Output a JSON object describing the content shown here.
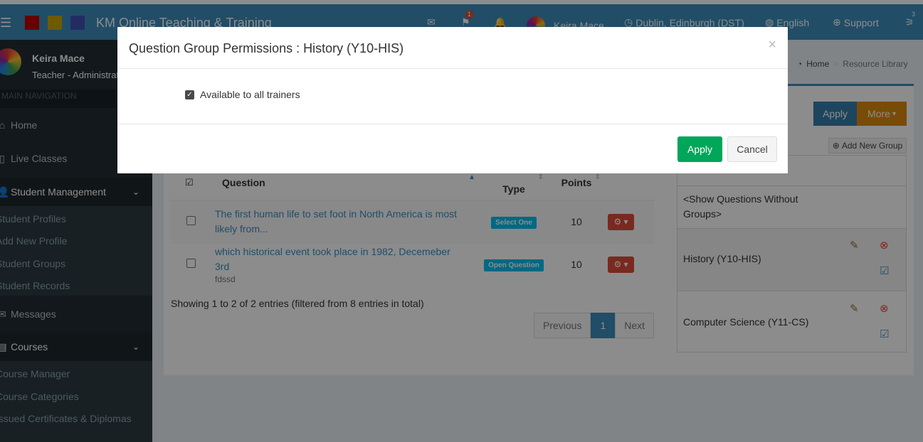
{
  "header": {
    "brand": "KM Online Teaching & Training",
    "flags_badge": "1",
    "user": "Keira Mace",
    "timezone": "Dublin, Edinburgh (DST)",
    "language": "English",
    "support": "Support",
    "rss_badge": "3",
    "colors": [
      "#c00000",
      "#c9a400",
      "#3f51b5"
    ]
  },
  "sidebar": {
    "user_name": "Keira Mace",
    "user_role": "Teacher - Administrator",
    "nav_header": "MAIN NAVIGATION",
    "items": [
      {
        "label": "Home",
        "icon": "home-icon"
      },
      {
        "label": "Live Classes",
        "icon": "file-icon"
      },
      {
        "label": "Student Management",
        "icon": "user-icon"
      },
      {
        "label": "Messages",
        "icon": "envelope-icon"
      },
      {
        "label": "Courses",
        "icon": "book-icon"
      }
    ],
    "student_sub": [
      "Student Profiles",
      "Add New Profile",
      "Student Groups",
      "Student Records"
    ],
    "courses_sub": [
      "Course Manager",
      "Course Categories",
      "Issued Certificates & Diplomas"
    ]
  },
  "breadcrumb": {
    "home": "Home",
    "current": "Resource Library"
  },
  "toolbar": {
    "apply": "Apply",
    "more": "More"
  },
  "groups_panel": {
    "add_label": "Add New Group",
    "show_without": "<Show Questions Without Groups>",
    "groups": [
      "History (Y10-HIS)",
      "Computer Science (Y11-CS)"
    ]
  },
  "table": {
    "headers": {
      "question": "Question",
      "type": "Type",
      "points": "Points"
    },
    "rows": [
      {
        "question": "The first human life to set foot in North America is most likely from...",
        "sub": "",
        "type": "Select One",
        "points": "10"
      },
      {
        "question": "which historical event took place in 1982, Decemeber 3rd",
        "sub": "fdssd",
        "type": "Open Question",
        "points": "10"
      }
    ],
    "info": "Showing 1 to 2 of 2 entries (filtered from 8 entries in total)",
    "pager": {
      "prev": "Previous",
      "page": "1",
      "next": "Next"
    }
  },
  "modal": {
    "title": "Question Group Permissions : History (Y10-HIS)",
    "checkbox_label": "Available to all trainers",
    "checked": true,
    "apply": "Apply",
    "cancel": "Cancel"
  }
}
